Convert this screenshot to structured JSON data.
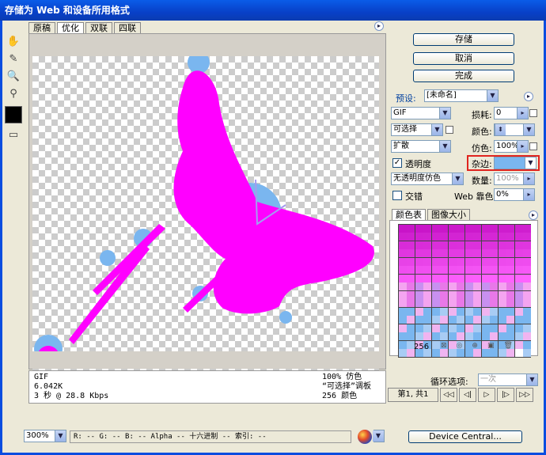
{
  "window": {
    "title": "存储为 Web 和设备所用格式"
  },
  "view_tabs": [
    {
      "label": "原稿"
    },
    {
      "label": "优化"
    },
    {
      "label": "双联"
    },
    {
      "label": "四联"
    }
  ],
  "actions": {
    "save": "存储",
    "cancel": "取消",
    "done": "完成"
  },
  "preset": {
    "label": "预设:",
    "value": "[未命名]"
  },
  "settings": {
    "format": "GIF",
    "lossy_label": "损耗:",
    "lossy_value": "0",
    "reduction": "可选择",
    "colors_label": "颜色:",
    "colors_value": "",
    "dither_algo": "扩散",
    "dither_label": "仿色:",
    "dither_value": "100%",
    "transparency_label": "透明度",
    "transparency_checked": true,
    "matte_label": "杂边:",
    "matte_color": "#7ab6ef",
    "transparency_dither": "无透明度仿色",
    "amount_label": "数量:",
    "amount_value": "100%",
    "interlaced_label": "交错",
    "interlaced_checked": false,
    "web_snap_label": "Web 靠色:",
    "web_snap_value": "0%"
  },
  "panel_tabs": [
    {
      "label": "颜色表"
    },
    {
      "label": "图像大小"
    }
  ],
  "color_table": {
    "count": "256"
  },
  "image_info": {
    "format": "GIF",
    "size": "6.042K",
    "time": "3 秒 @ 28.8 Kbps",
    "dither": "100% 仿色",
    "palette": "“可选择”调板",
    "colors": "256 颜色"
  },
  "loop": {
    "label": "循环选项:",
    "value": "一次"
  },
  "animation": {
    "frame_counter": "第1, 共1"
  },
  "status": {
    "zoom": "300%",
    "fields": "R: -- G: -- B: -- Alpha -- 十六进制   -- 索引: --"
  },
  "device_central": "Device Central...",
  "colors": {
    "accent": "#0a4de0",
    "magenta": "#ff00ff",
    "matte": "#7ab6ef",
    "highlight": "#e0241e"
  }
}
